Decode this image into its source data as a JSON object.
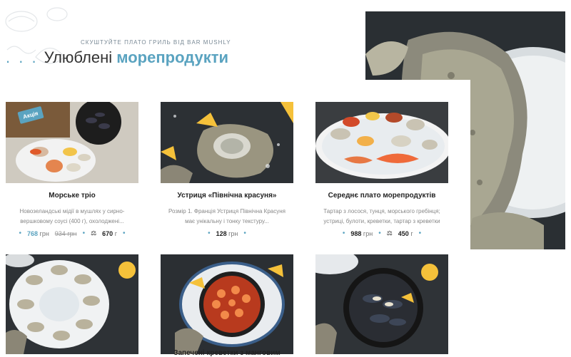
{
  "header": {
    "kicker": "Скуштуйте плато гриль від bar mushly",
    "dots": ". . .",
    "title_plain": "Улюблені",
    "title_accent": "морепродукти"
  },
  "hero": {
    "image": "oyster-closeup",
    "alt": ""
  },
  "products": [
    {
      "name": "Морське тріо",
      "badge": "Акція",
      "description": "Новозеландські мідії в мушлях у сирно-вершковому соусі (400 г), охолоджені...",
      "price": "768",
      "old_price": "934 грн",
      "currency": "грн",
      "weight": "670",
      "weight_unit": "г"
    },
    {
      "name": "Устриця «Північна красуня»",
      "description": "Розмір 1. Франція Устриця Північна Красуня має унікальну і тонку текстуру...",
      "price": "128",
      "currency": "грн"
    },
    {
      "name": "Середнє плато морепродуктів",
      "description": "Тартар з лосося, тунця, морського гребінця; устриці, булоти, креветки, тартар з креветки",
      "price": "988",
      "currency": "грн",
      "weight": "450",
      "weight_unit": "г"
    },
    {
      "name": "",
      "image": "oysters-platter"
    },
    {
      "name": "Запечені креветки з манговим",
      "image": "baked-shrimp-pan"
    },
    {
      "name": "",
      "image": "mussels-pot"
    }
  ],
  "colors": {
    "accent": "#5aa3c0",
    "text": "#222222",
    "muted": "#888888"
  }
}
